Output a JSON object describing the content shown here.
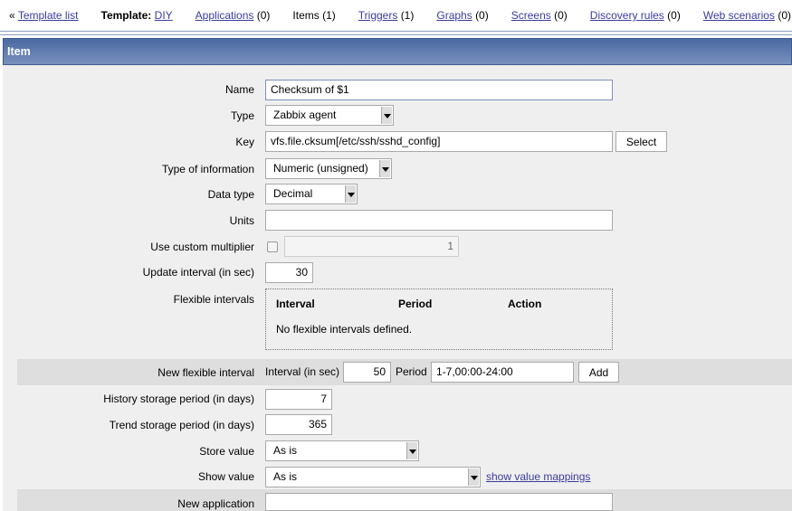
{
  "nav": {
    "prefix": "«",
    "template_list": "Template list",
    "template_label": "Template:",
    "template_name": "DIY",
    "links": [
      {
        "label": "Applications",
        "count": "(0)",
        "link": true
      },
      {
        "label": "Items",
        "count": "(1)",
        "link": false
      },
      {
        "label": "Triggers",
        "count": "(1)",
        "link": true
      },
      {
        "label": "Graphs",
        "count": "(0)",
        "link": true
      },
      {
        "label": "Screens",
        "count": "(0)",
        "link": true
      },
      {
        "label": "Discovery rules",
        "count": "(0)",
        "link": true
      },
      {
        "label": "Web scenarios",
        "count": "(0)",
        "link": true
      }
    ]
  },
  "header": {
    "title": "Item"
  },
  "form": {
    "name": {
      "label": "Name",
      "value": "Checksum of $1"
    },
    "type": {
      "label": "Type",
      "value": "Zabbix agent"
    },
    "key": {
      "label": "Key",
      "value": "vfs.file.cksum[/etc/ssh/sshd_config]",
      "button": "Select"
    },
    "type_of_information": {
      "label": "Type of information",
      "value": "Numeric (unsigned)"
    },
    "data_type": {
      "label": "Data type",
      "value": "Decimal"
    },
    "units": {
      "label": "Units",
      "value": ""
    },
    "custom_multiplier": {
      "label": "Use custom multiplier",
      "checked": false,
      "value": "1"
    },
    "update_interval": {
      "label": "Update interval (in sec)",
      "value": "30"
    },
    "flexible_intervals": {
      "label": "Flexible intervals",
      "columns": [
        "Interval",
        "Period",
        "Action"
      ],
      "empty": "No flexible intervals defined."
    },
    "new_flexible_interval": {
      "label": "New flexible interval",
      "interval_label": "Interval (in sec)",
      "interval_value": "50",
      "period_label": "Period",
      "period_value": "1-7,00:00-24:00",
      "button": "Add"
    },
    "history": {
      "label": "History storage period (in days)",
      "value": "7"
    },
    "trends": {
      "label": "Trend storage period (in days)",
      "value": "365"
    },
    "store_value": {
      "label": "Store value",
      "value": "As is"
    },
    "show_value": {
      "label": "Show value",
      "value": "As is",
      "link": "show value mappings"
    },
    "new_application": {
      "label": "New application",
      "value": ""
    }
  }
}
